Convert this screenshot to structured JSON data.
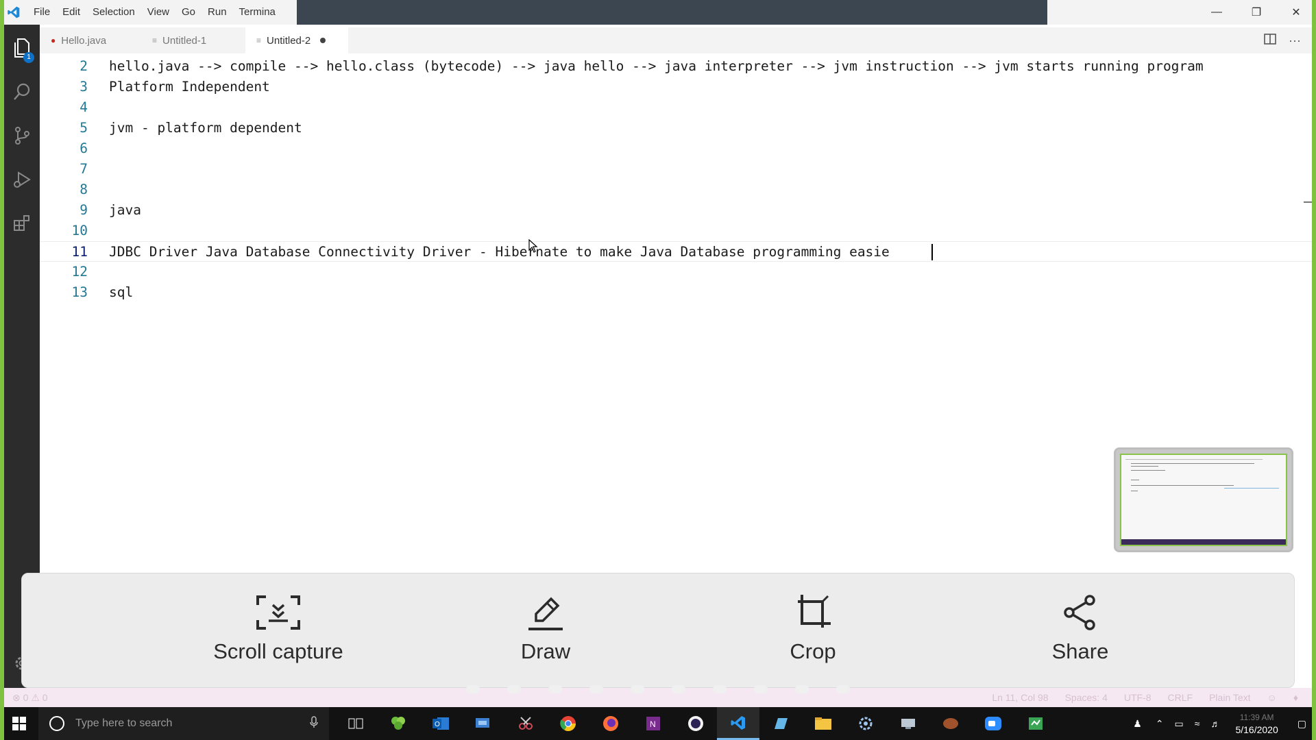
{
  "titlebar": {
    "menu": [
      "File",
      "Edit",
      "Selection",
      "View",
      "Go",
      "Run",
      "Termina"
    ]
  },
  "activity": {
    "explorer_badge": "1"
  },
  "tabs": [
    {
      "label": "Hello.java",
      "state": "error"
    },
    {
      "label": "Untitled-1",
      "state": "normal"
    },
    {
      "label": "Untitled-2",
      "state": "active-modified"
    }
  ],
  "editor": {
    "lines": [
      {
        "num": "2",
        "text": "hello.java --> compile --> hello.class (bytecode) --> java hello --> java interpreter --> jvm instruction --> jvm starts running program"
      },
      {
        "num": "3",
        "text": "Platform Independent"
      },
      {
        "num": "4",
        "text": ""
      },
      {
        "num": "5",
        "text": "jvm - platform dependent"
      },
      {
        "num": "6",
        "text": ""
      },
      {
        "num": "7",
        "text": ""
      },
      {
        "num": "8",
        "text": ""
      },
      {
        "num": "9",
        "text": "java"
      },
      {
        "num": "10",
        "text": ""
      },
      {
        "num": "11",
        "text": "JDBC Driver Java Database Connectivity Driver - Hibernate to make Java Database programming easie"
      },
      {
        "num": "12",
        "text": ""
      },
      {
        "num": "13",
        "text": "sql"
      }
    ]
  },
  "capture_toolbar": {
    "scroll_capture": "Scroll capture",
    "draw": "Draw",
    "crop": "Crop",
    "share": "Share"
  },
  "statusbar": {
    "errors": "0",
    "warnings": "0",
    "position": "Ln 11, Col 98",
    "spaces": "Spaces: 4",
    "encoding": "UTF-8",
    "eol": "CRLF",
    "language": "Plain Text"
  },
  "taskbar": {
    "search_placeholder": "Type here to search",
    "time": "11:39 AM",
    "date": "5/16/2020"
  },
  "colors": {
    "frame_green": "#7fc242",
    "line_number": "#237893",
    "activity_bar": "#2c2c2c",
    "accent_blue": "#0e71c8"
  }
}
